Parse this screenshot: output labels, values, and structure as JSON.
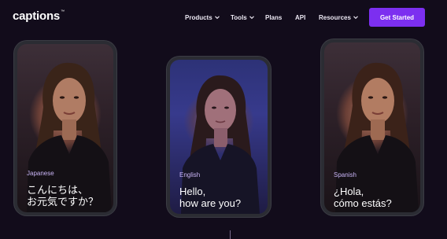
{
  "nav": {
    "logo": "captions",
    "logo_mark": "™",
    "items": [
      {
        "label": "Products",
        "has_dropdown": true
      },
      {
        "label": "Tools",
        "has_dropdown": true
      },
      {
        "label": "Plans",
        "has_dropdown": false
      },
      {
        "label": "API",
        "has_dropdown": false
      },
      {
        "label": "Resources",
        "has_dropdown": true
      }
    ],
    "cta_label": "Get Started"
  },
  "phones": [
    {
      "language": "Japanese",
      "caption": [
        "こんにちは、",
        "お元気ですか？"
      ]
    },
    {
      "language": "English",
      "caption": [
        "Hello,",
        "how are you?"
      ]
    },
    {
      "language": "Spanish",
      "caption": [
        "¿Hola,",
        "cómo estás?"
      ]
    }
  ],
  "colors": {
    "background": "#120c1b",
    "cta": "#7c2ff0",
    "language_label": "#c9b4f5"
  }
}
